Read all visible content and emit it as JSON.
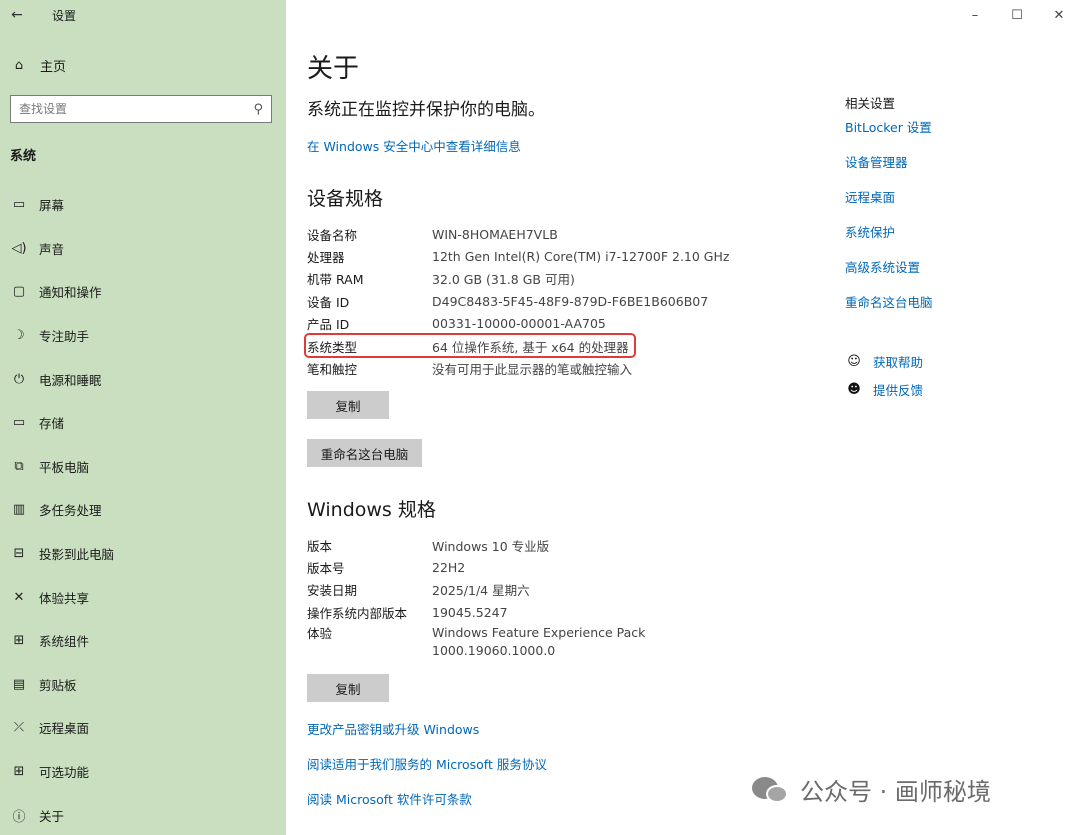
{
  "window": {
    "title": "设置",
    "controls": {
      "minimize": "–",
      "maximize": "☐",
      "close": "✕"
    }
  },
  "sidebar": {
    "back_glyph": "←",
    "home": {
      "icon": "⌂",
      "label": "主页"
    },
    "search": {
      "placeholder": "查找设置",
      "icon": "⚲"
    },
    "section": "系统",
    "items": [
      {
        "icon": "▭",
        "label": "屏幕"
      },
      {
        "icon": "◁)",
        "label": "声音"
      },
      {
        "icon": "▢",
        "label": "通知和操作"
      },
      {
        "icon": "☽",
        "label": "专注助手"
      },
      {
        "icon": "⏻",
        "label": "电源和睡眠"
      },
      {
        "icon": "▭",
        "label": "存储"
      },
      {
        "icon": "⧉",
        "label": "平板电脑"
      },
      {
        "icon": "▥",
        "label": "多任务处理"
      },
      {
        "icon": "⊟",
        "label": "投影到此电脑"
      },
      {
        "icon": "✕",
        "label": "体验共享"
      },
      {
        "icon": "⊞",
        "label": "系统组件"
      },
      {
        "icon": "▤",
        "label": "剪贴板"
      },
      {
        "icon": "⤫",
        "label": "远程桌面"
      },
      {
        "icon": "⊞",
        "label": "可选功能"
      },
      {
        "icon": "ⓘ",
        "label": "关于"
      }
    ]
  },
  "main": {
    "title": "关于",
    "subtitle": "系统正在监控并保护你的电脑。",
    "security_link": "在 Windows 安全中心中查看详细信息",
    "device_specs": {
      "heading": "设备规格",
      "rows": [
        {
          "k": "设备名称",
          "v": "WIN-8HOMAEH7VLB"
        },
        {
          "k": "处理器",
          "v": "12th Gen Intel(R) Core(TM) i7-12700F   2.10 GHz"
        },
        {
          "k": "机带 RAM",
          "v": "32.0 GB (31.8 GB 可用)"
        },
        {
          "k": "设备 ID",
          "v": "D49C8483-5F45-48F9-879D-F6BE1B606B07"
        },
        {
          "k": "产品 ID",
          "v": "00331-10000-00001-AA705"
        },
        {
          "k": "系统类型",
          "v": "64 位操作系统, 基于 x64 的处理器"
        },
        {
          "k": "笔和触控",
          "v": "没有可用于此显示器的笔或触控输入"
        }
      ],
      "copy_button": "复制",
      "rename_button": "重命名这台电脑"
    },
    "windows_specs": {
      "heading": "Windows 规格",
      "rows": [
        {
          "k": "版本",
          "v": "Windows 10 专业版"
        },
        {
          "k": "版本号",
          "v": "22H2"
        },
        {
          "k": "安装日期",
          "v": "2025/1/4 星期六"
        },
        {
          "k": "操作系统内部版本",
          "v": "19045.5247"
        },
        {
          "k": "体验",
          "v": "Windows Feature Experience Pack"
        },
        {
          "k": "",
          "v": "1000.19060.1000.0"
        }
      ],
      "copy_button": "复制"
    },
    "links": [
      "更改产品密钥或升级 Windows",
      "阅读适用于我们服务的 Microsoft 服务协议",
      "阅读 Microsoft 软件许可条款"
    ]
  },
  "related": {
    "heading": "相关设置",
    "links": [
      "BitLocker 设置",
      "设备管理器",
      "远程桌面",
      "系统保护",
      "高级系统设置",
      "重命名这台电脑"
    ],
    "help": {
      "icon": "☺",
      "label": "获取帮助"
    },
    "feedback": {
      "icon": "☻",
      "label": "提供反馈"
    }
  },
  "watermark": "公众号 · 画师秘境"
}
